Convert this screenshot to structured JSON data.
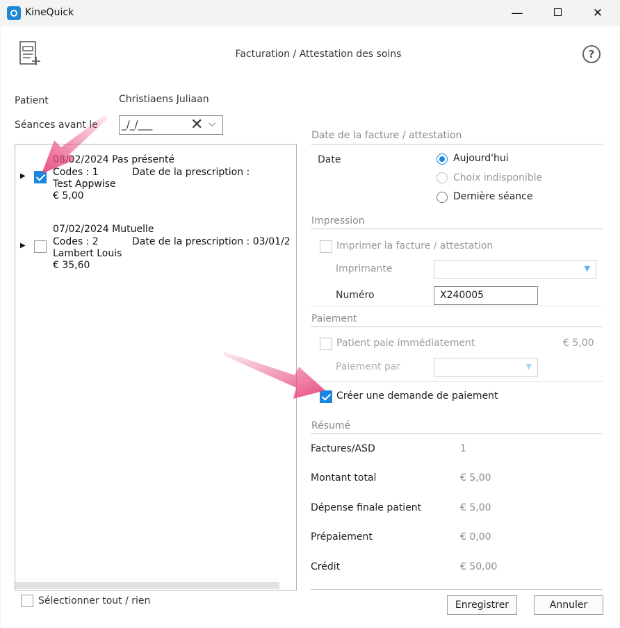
{
  "window": {
    "title": "KineQuick",
    "minimize": "—",
    "close": "✕"
  },
  "header": {
    "title": "Facturation / Attestation des soins",
    "help": "?"
  },
  "patient": {
    "label": "Patient",
    "name": "Christiaens Juliaan"
  },
  "seances_filter": {
    "label": "Séances avant le",
    "value": "_/_/___",
    "clear": "✕",
    "drop": "⌵"
  },
  "sessions": [
    {
      "line1": "08/02/2024 Pas présenté",
      "codes": "Codes : 1",
      "prescription": "Date de la prescription :",
      "name": "Test Appwise",
      "amount": "€ 5,00",
      "checked": true
    },
    {
      "line1": "07/02/2024 Mutuelle",
      "codes": "Codes : 2",
      "prescription": "Date de la prescription : 03/01/2",
      "name": "Lambert Louis",
      "amount": "€ 35,60",
      "checked": false
    }
  ],
  "select_all": "Sélectionner tout / rien",
  "date_section": {
    "title": "Date de la facture / attestation",
    "label": "Date",
    "options": [
      "Aujourd'hui",
      "Choix indisponible",
      "Dernière séance"
    ],
    "selected": 0
  },
  "impression": {
    "title": "Impression",
    "print_label": "Imprimer la facture / attestation",
    "printer_label": "Imprimante",
    "printer_value": "",
    "number_label": "Numéro",
    "number_value": "X240005"
  },
  "paiement": {
    "title": "Paiement",
    "immediate_label": "Patient paie immédiatement",
    "immediate_amount": "€ 5,00",
    "by_label": "Paiement par",
    "by_value": "",
    "request_label": "Créer une demande de paiement",
    "request_checked": true
  },
  "resume": {
    "title": "Résumé",
    "rows": [
      {
        "label": "Factures/ASD",
        "value": "1"
      },
      {
        "label": "Montant total",
        "value": "€ 5,00"
      },
      {
        "label": "Dépense finale patient",
        "value": "€ 5,00"
      },
      {
        "label": "Prépaiement",
        "value": "€ 0,00"
      },
      {
        "label": "Crédit",
        "value": "€ 50,00"
      }
    ]
  },
  "buttons": {
    "save": "Enregistrer",
    "cancel": "Annuler"
  },
  "colors": {
    "accent": "#1a86e0",
    "annotation_arrow": "#e8467a"
  }
}
